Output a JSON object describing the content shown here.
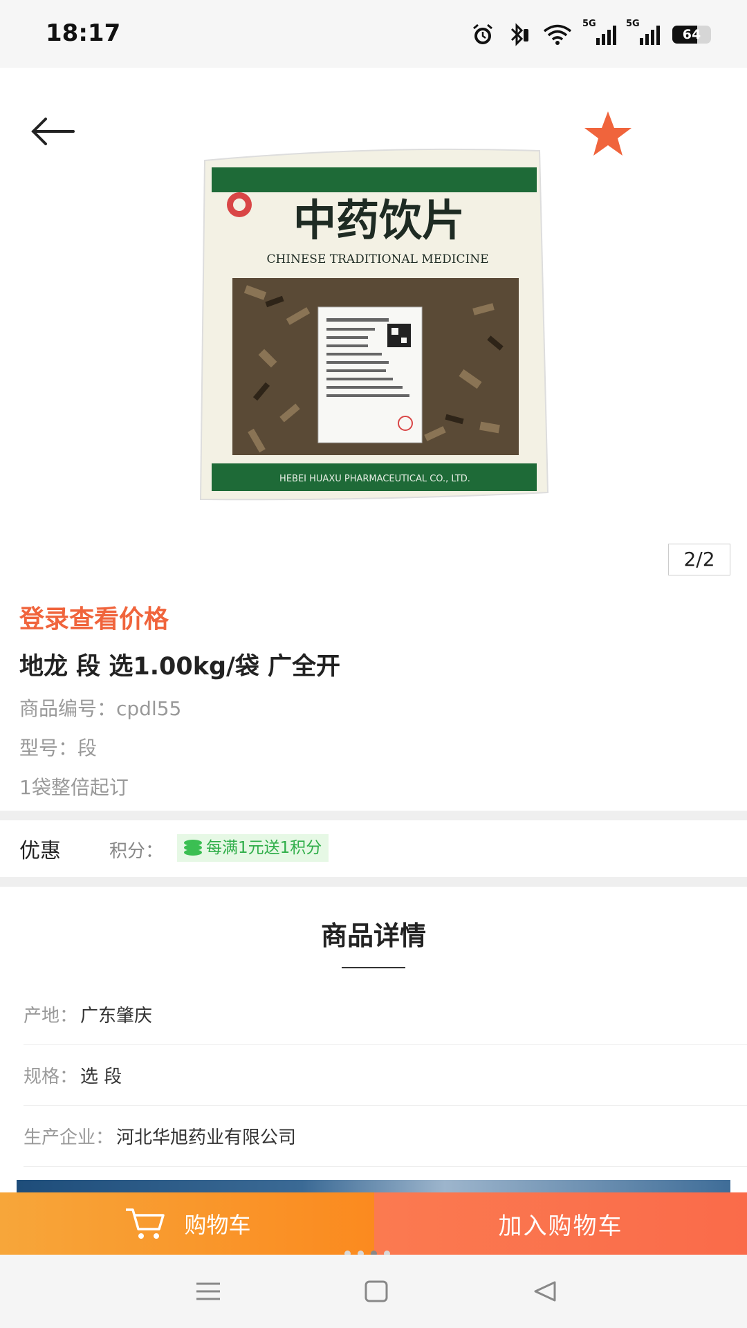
{
  "status_bar": {
    "time": "18:17",
    "network_1": "5G",
    "network_2": "5G",
    "battery_percent": 64,
    "battery_label": "64"
  },
  "hero": {
    "back_icon": "arrow-left-icon",
    "favorite_icon": "star-icon",
    "favorite_color": "#f0643c",
    "package_title": "中药饮片",
    "package_subtitle": "CHINESE TRADITIONAL MEDICINE",
    "package_footer": "HEBEI HUAXU PHARMACEUTICAL CO., LTD.",
    "page_indicator": "2/2"
  },
  "product": {
    "login_price": "登录查看价格",
    "title": "地龙 段 选1.00kg/袋 广全开",
    "code": "商品编号：cpdl55",
    "model": "型号：段",
    "min_order": "1袋整倍起订"
  },
  "promo": {
    "label": "优惠",
    "points_label": "积分：",
    "points_badge": "每满1元送1积分",
    "badge_icon": "coins-icon"
  },
  "details": {
    "title": "商品详情",
    "rows": [
      {
        "key": "产地：",
        "value": "广东肇庆"
      },
      {
        "key": "规格：",
        "value": "选 段"
      },
      {
        "key": "生产企业：",
        "value": "河北华旭药业有限公司"
      }
    ]
  },
  "actions": {
    "cart_label": "购物车",
    "cart_icon": "cart-icon",
    "add_label": "加入购物车",
    "carousel_active_index": 3
  },
  "system_nav": {
    "menu_icon": "menu-icon",
    "home_icon": "home-icon",
    "back_icon": "back-triangle-icon"
  },
  "colors": {
    "accent": "#f0643c",
    "cart_button": "#fb8a1f",
    "add_button": "#fa6b4a",
    "badge_green": "#2fae49",
    "package_green": "#1e6a37"
  }
}
